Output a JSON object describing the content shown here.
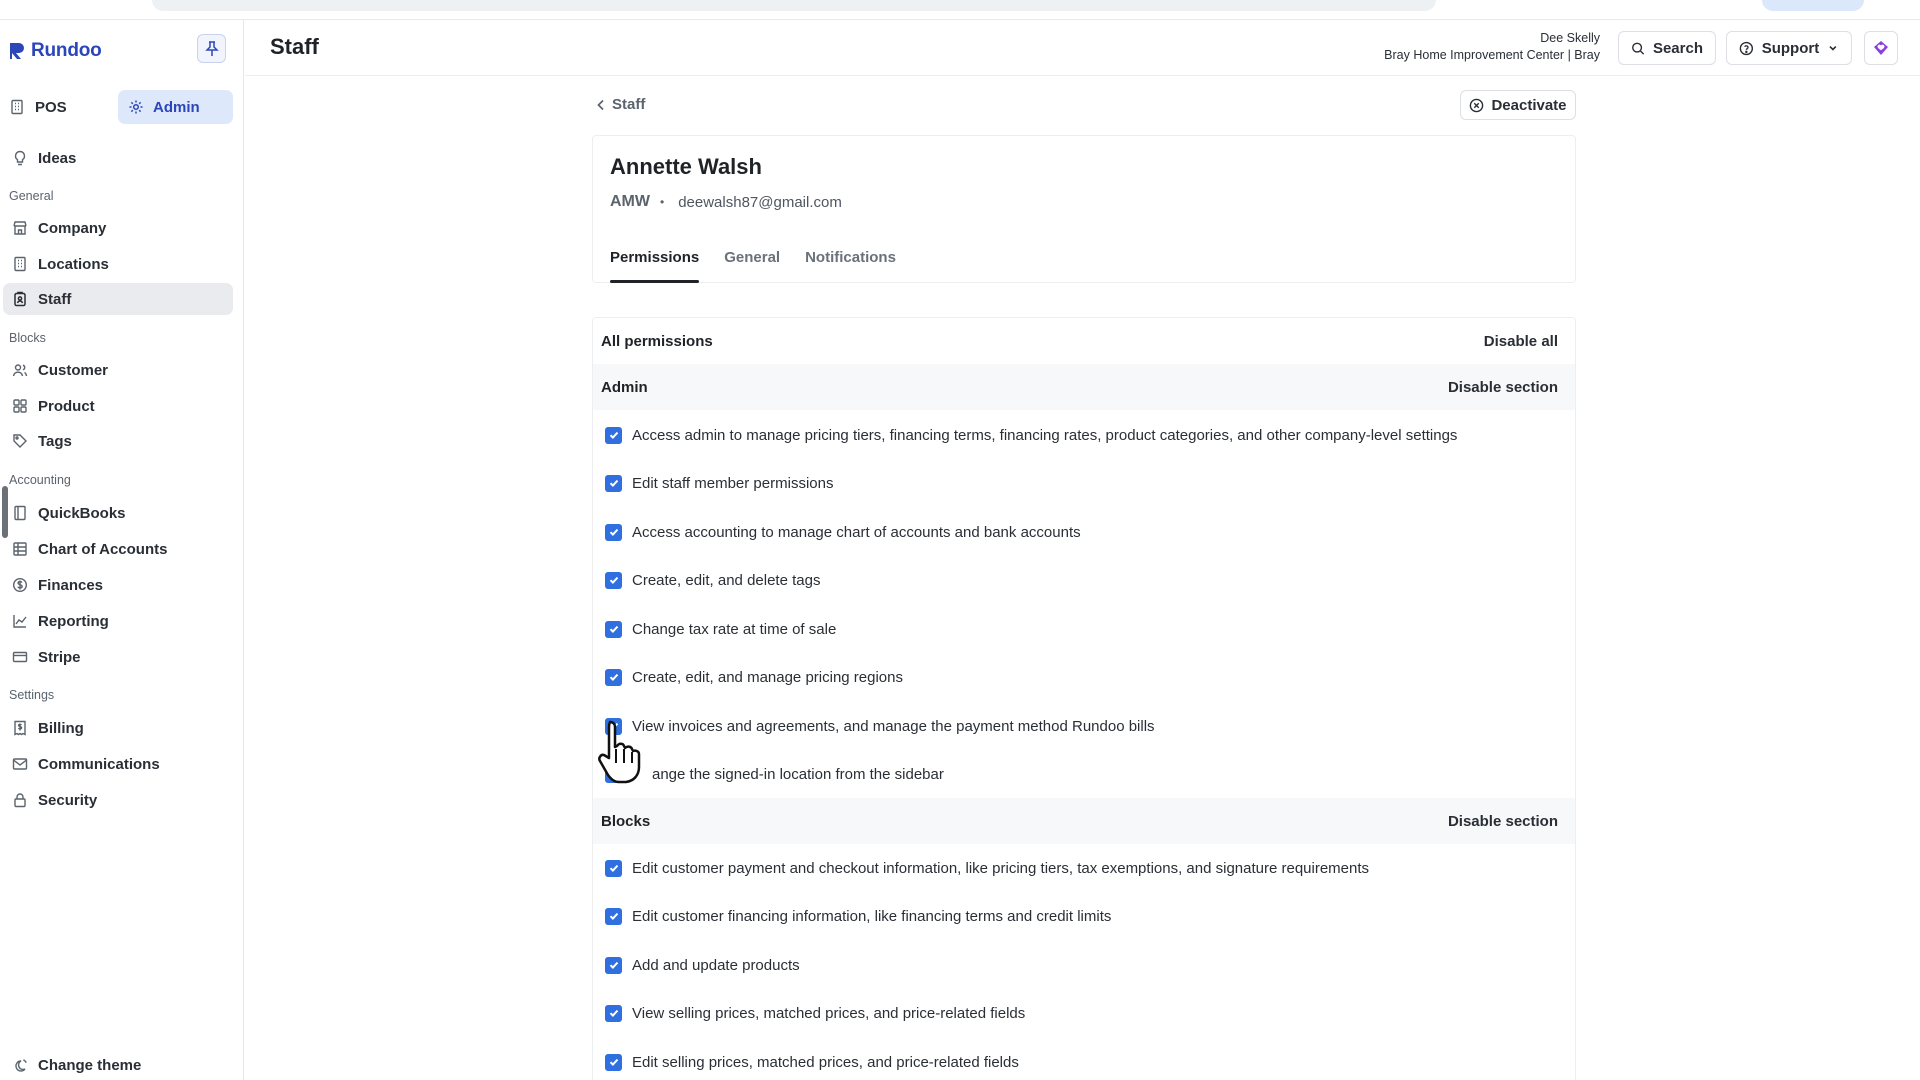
{
  "app": {
    "brand": "Rundoo"
  },
  "sidebar": {
    "modes": {
      "pos": "POS",
      "admin": "Admin"
    },
    "ideas": "Ideas",
    "sections": [
      {
        "label": "General",
        "items": [
          {
            "label": "Company",
            "icon": "store-icon"
          },
          {
            "label": "Locations",
            "icon": "building-icon"
          },
          {
            "label": "Staff",
            "icon": "badge-icon",
            "active": true
          }
        ]
      },
      {
        "label": "Blocks",
        "items": [
          {
            "label": "Customer",
            "icon": "users-icon"
          },
          {
            "label": "Product",
            "icon": "grid-icon"
          },
          {
            "label": "Tags",
            "icon": "tag-icon"
          }
        ]
      },
      {
        "label": "Accounting",
        "items": [
          {
            "label": "QuickBooks",
            "icon": "book-icon"
          },
          {
            "label": "Chart of Accounts",
            "icon": "table-icon"
          },
          {
            "label": "Finances",
            "icon": "dollar-circle-icon"
          },
          {
            "label": "Reporting",
            "icon": "line-chart-icon"
          },
          {
            "label": "Stripe",
            "icon": "card-icon"
          }
        ]
      },
      {
        "label": "Settings",
        "items": [
          {
            "label": "Billing",
            "icon": "receipt-icon"
          },
          {
            "label": "Communications",
            "icon": "mail-icon"
          },
          {
            "label": "Security",
            "icon": "lock-icon"
          }
        ]
      }
    ],
    "change_theme": "Change theme"
  },
  "header": {
    "title": "Staff",
    "user_name": "Dee Skelly",
    "user_org": "Bray Home Improvement Center | Bray",
    "search_label": "Search",
    "support_label": "Support"
  },
  "staff": {
    "back_label": "Staff",
    "deactivate_label": "Deactivate",
    "name": "Annette Walsh",
    "initials": "AMW",
    "separator": "•",
    "email": "deewalsh87@gmail.com",
    "tabs": [
      {
        "label": "Permissions",
        "active": true
      },
      {
        "label": "General",
        "active": false
      },
      {
        "label": "Notifications",
        "active": false
      }
    ]
  },
  "permissions": {
    "header": "All permissions",
    "disable_all": "Disable all",
    "sections": [
      {
        "title": "Admin",
        "action": "Disable section",
        "items": [
          {
            "label": "Access admin to manage pricing tiers, financing terms, financing rates, product categories, and other company-level settings",
            "checked": true
          },
          {
            "label": "Edit staff member permissions",
            "checked": true
          },
          {
            "label": "Access accounting to manage chart of accounts and bank accounts",
            "checked": true
          },
          {
            "label": "Create, edit, and delete tags",
            "checked": true
          },
          {
            "label": "Change tax rate at time of sale",
            "checked": true
          },
          {
            "label": "Create, edit, and manage pricing regions",
            "checked": true
          },
          {
            "label": "View invoices and agreements, and manage the payment method Rundoo bills",
            "checked": true
          },
          {
            "label": "ange the signed-in location from the sidebar",
            "checked": true
          }
        ]
      },
      {
        "title": "Blocks",
        "action": "Disable section",
        "items": [
          {
            "label": "Edit customer payment and checkout information, like pricing tiers, tax exemptions, and signature requirements",
            "checked": true
          },
          {
            "label": "Edit customer financing information, like financing terms and credit limits",
            "checked": true
          },
          {
            "label": "Add and update products",
            "checked": true
          },
          {
            "label": "View selling prices, matched prices, and price-related fields",
            "checked": true
          },
          {
            "label": "Edit selling prices, matched prices, and price-related fields",
            "checked": true
          }
        ]
      }
    ]
  },
  "colors": {
    "accent": "#2b46b8",
    "checkbox": "#2f6fe0",
    "active_nav_bg": "#e9ebee",
    "admin_bg": "#dde8fb"
  }
}
